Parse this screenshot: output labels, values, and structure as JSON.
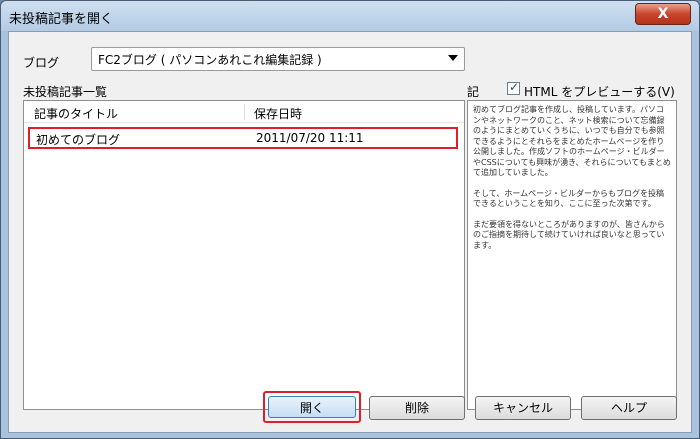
{
  "window": {
    "title": "未投稿記事を開く",
    "close_label": "X"
  },
  "blog": {
    "label": "ブログ",
    "selected": "FC2ブログ ( パソコンあれこれ編集記録 )"
  },
  "list": {
    "label": "未投稿記事一覧",
    "columns": [
      "記事のタイトル",
      "保存日時"
    ],
    "rows": [
      {
        "title": "初めてのブログ",
        "date": "2011/07/20 11:11"
      }
    ]
  },
  "preview": {
    "label": "記",
    "checkbox_label": "HTML をプレビューする(V)",
    "checked": true,
    "paragraphs": [
      "初めてブログ記事を作成し、投稿しています。パソコンやネットワークのこと、ネット検索について忘備録のようにまとめていくうちに、いつでも自分でも参照できるようにとそれらをまとめたホームページを作り公開しました。作成ソフトのホームページ・ビルダーやCSSについても興味が湧き、それらについてもまとめて追加していました。",
      "そして、ホームページ・ビルダーからもブログを投稿できるということを知り、ここに至った次第です。",
      "まだ要領を得ないところがありますのが、皆さんからのご指摘を期待して続けていければ良いなと思っています。"
    ]
  },
  "buttons": {
    "open": "開く",
    "delete": "削除",
    "cancel": "キャンセル",
    "help": "ヘルプ"
  }
}
